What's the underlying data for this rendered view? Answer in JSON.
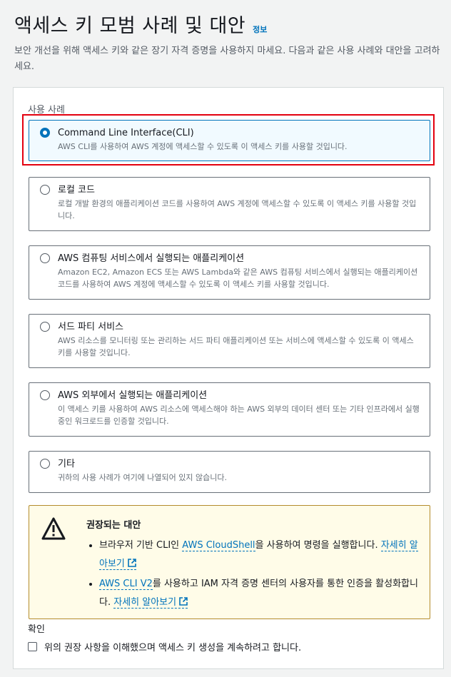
{
  "header": {
    "title": "액세스 키 모범 사례 및 대안",
    "info_link": "정보",
    "description": "보안 개선을 위해 액세스 키와 같은 장기 자격 증명을 사용하지 마세요. 다음과 같은 사용 사례와 대안을 고려하세요."
  },
  "use_case": {
    "section_label": "사용 사례",
    "selected_index": 0,
    "options": [
      {
        "title": "Command Line Interface(CLI)",
        "description": "AWS CLI를 사용하여 AWS 계정에 액세스할 수 있도록 이 액세스 키를 사용할 것입니다."
      },
      {
        "title": "로컬 코드",
        "description": "로컬 개발 환경의 애플리케이션 코드를 사용하여 AWS 계정에 액세스할 수 있도록 이 액세스 키를 사용할 것입니다."
      },
      {
        "title": "AWS 컴퓨팅 서비스에서 실행되는 애플리케이션",
        "description": "Amazon EC2, Amazon ECS 또는 AWS Lambda와 같은 AWS 컴퓨팅 서비스에서 실행되는 애플리케이션 코드를 사용하여 AWS 계정에 액세스할 수 있도록 이 액세스 키를 사용할 것입니다."
      },
      {
        "title": "서드 파티 서비스",
        "description": "AWS 리소스를 모니터링 또는 관리하는 서드 파티 애플리케이션 또는 서비스에 액세스할 수 있도록 이 액세스 키를 사용할 것입니다."
      },
      {
        "title": "AWS 외부에서 실행되는 애플리케이션",
        "description": "이 액세스 키를 사용하여 AWS 리소스에 액세스해야 하는 AWS 외부의 데이터 센터 또는 기타 인프라에서 실행 중인 워크로드를 인증할 것입니다."
      },
      {
        "title": "기타",
        "description": "귀하의 사용 사례가 여기에 나열되어 있지 않습니다."
      }
    ]
  },
  "alert": {
    "title": "권장되는 대안",
    "item1_pre": "브라우저 기반 CLI인 ",
    "item1_link": "AWS CloudShell",
    "item1_post": "을 사용하여 명령을 실행합니다. ",
    "item1_more": "자세히 알아보기",
    "item2_link": "AWS CLI V2",
    "item2_post": "를 사용하고 IAM 자격 증명 센터의 사용자를 통한 인증을 활성화합니다. ",
    "item2_more": "자세히 알아보기"
  },
  "confirm": {
    "label": "확인",
    "checkbox_text": "위의 권장 사항을 이해했으며 액세스 키 생성을 계속하려고 합니다."
  },
  "colors": {
    "accent": "#0073bb",
    "highlight": "#e3000f",
    "warning_bg": "#fffce8"
  }
}
